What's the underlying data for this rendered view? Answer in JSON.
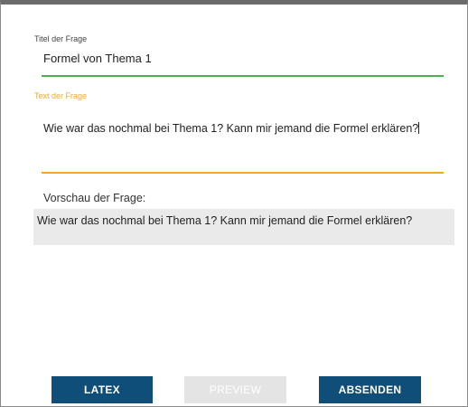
{
  "form": {
    "title_label": "Titel der Frage",
    "title_value": "Formel von Thema 1",
    "text_label": "Text der Frage",
    "text_value": "Wie war das nochmal bei Thema 1? Kann mir jemand die Formel erklären?",
    "preview_label": "Vorschau der Frage:",
    "preview_text": "Wie war das nochmal bei Thema 1? Kann mir jemand die Formel erklären?"
  },
  "buttons": {
    "latex_label": "LATEX",
    "preview_label": "PREVIEW",
    "send_label": "ABSENDEN"
  },
  "colors": {
    "title_underline": "#4caf50",
    "text_underline": "#f5a623",
    "text_label": "#f0a830",
    "button_primary": "#0f4e78",
    "button_disabled": "#e4e4e4",
    "preview_background": "#eaeaea"
  }
}
